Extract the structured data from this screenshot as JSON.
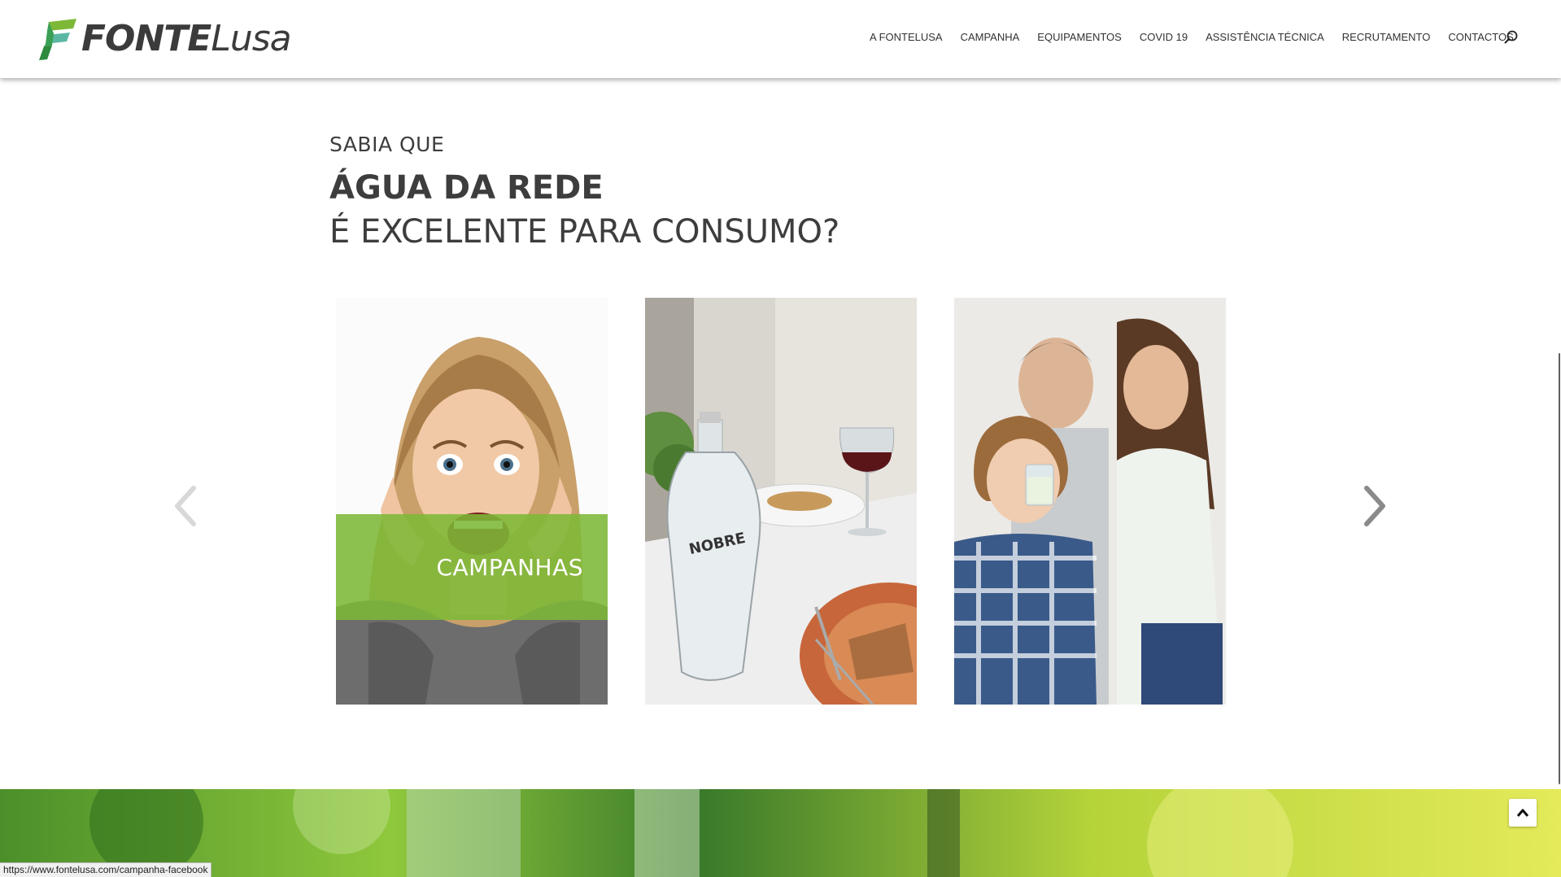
{
  "brand": {
    "logo_fonte": "FONTE",
    "logo_lusa": "Lusa",
    "logo_mark_icon": "fontelusa-leaf-f-icon",
    "green": "#7db837",
    "dark_green": "#2e8a3e",
    "teal": "#5bb7a3"
  },
  "nav": {
    "items": [
      {
        "label": "A FONTELUSA"
      },
      {
        "label": "CAMPANHA"
      },
      {
        "label": "EQUIPAMENTOS"
      },
      {
        "label": "COVID 19"
      },
      {
        "label": "ASSISTÊNCIA TÉCNICA"
      },
      {
        "label": "RECRUTAMENTO"
      },
      {
        "label": "CONTACTOS"
      }
    ],
    "search_icon": "search-icon"
  },
  "intro": {
    "pre": "SABIA QUE",
    "headline": "ÁGUA DA REDE",
    "subline": "É EXCELENTE PARA CONSUMO?"
  },
  "carousel": {
    "prev_icon": "chevron-left-icon",
    "next_icon": "chevron-right-icon",
    "cards": [
      {
        "image": "surprised-woman-photo",
        "overlay_label": "CAMPANHAS"
      },
      {
        "image": "water-bottle-dining-table-photo"
      },
      {
        "image": "family-boy-drinking-water-photo"
      }
    ]
  },
  "back_to_top_icon": "chevron-up-icon",
  "status_bar": {
    "url": "https://www.fontelusa.com/campanha-facebook"
  }
}
